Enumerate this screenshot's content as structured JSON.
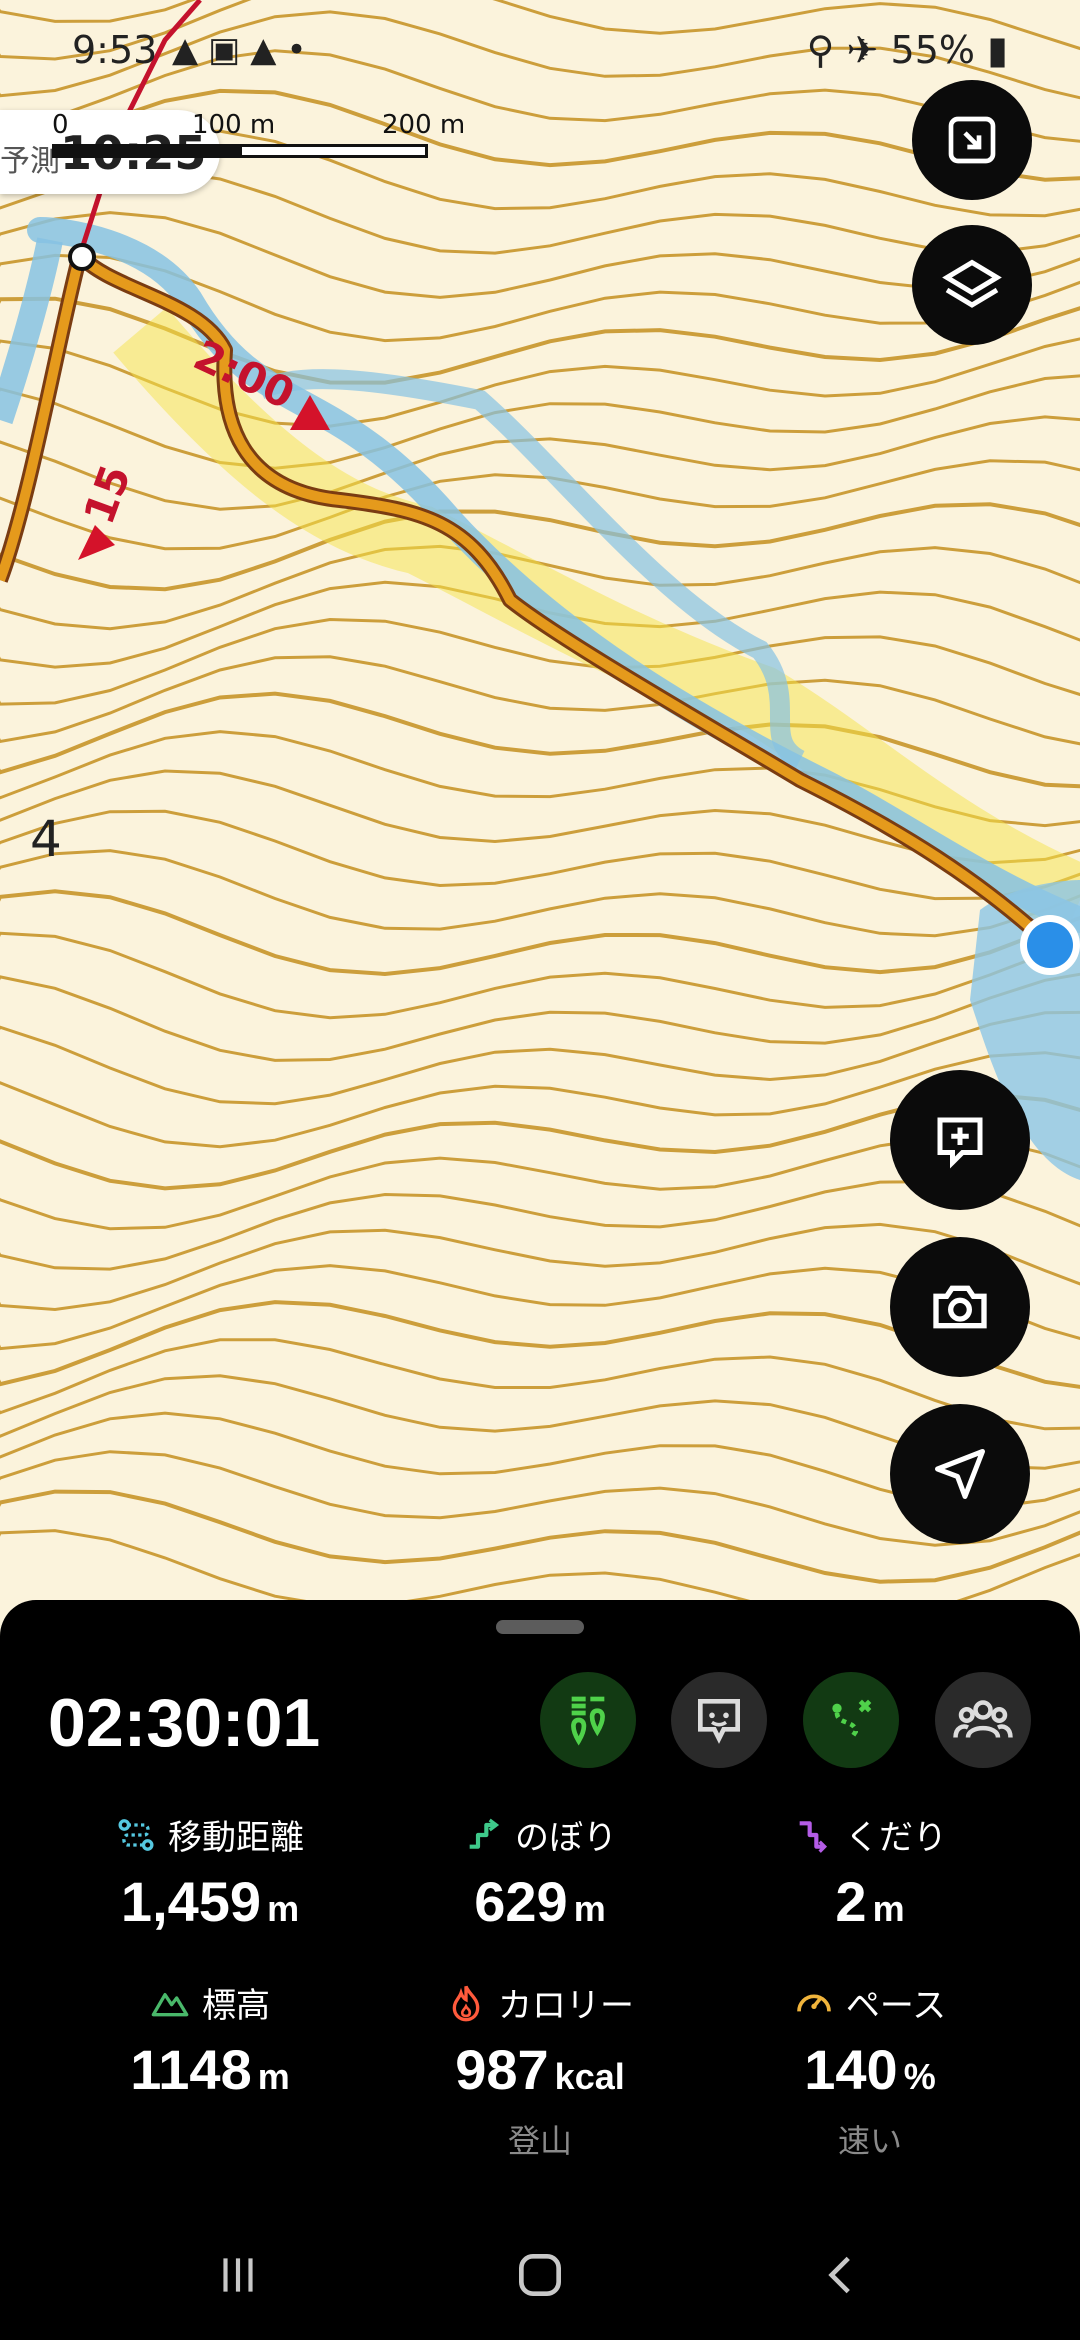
{
  "status_bar": {
    "time": "9:53",
    "left_icons": [
      "navigation-arrow-icon",
      "image-icon",
      "navigation-arrow-icon",
      "dot-icon"
    ],
    "right_icons": [
      "location-icon",
      "airplane-icon",
      "battery-icon"
    ],
    "battery": "55%"
  },
  "map": {
    "eta_label": "予測",
    "eta_value": "10:25",
    "scale_labels": [
      "0",
      "100 m",
      "200 m"
    ],
    "route_labels": [
      "2:00",
      "15"
    ],
    "contour_label": "4",
    "colors": {
      "contour": "#c8952a",
      "track": "#86c2e3",
      "route": "#e59a1c",
      "route_outline": "#7a3c12",
      "location": "#2a8fe8"
    }
  },
  "map_buttons": [
    {
      "name": "fullscreen-button",
      "icon": "expand-icon"
    },
    {
      "name": "layers-button",
      "icon": "layers-icon"
    },
    {
      "name": "add-memo-button",
      "icon": "add-comment-icon"
    },
    {
      "name": "camera-button",
      "icon": "camera-icon"
    },
    {
      "name": "navigate-button",
      "icon": "navigation-icon"
    }
  ],
  "panel": {
    "elapsed_time": "02:30:01",
    "toolbar": [
      {
        "name": "checkpoint-button",
        "icon": "pins-icon",
        "color": "#4fd14a"
      },
      {
        "name": "message-button",
        "icon": "chat-icon",
        "color": "#dcdcdc"
      },
      {
        "name": "route-button",
        "icon": "route-icon",
        "color": "#4fd14a"
      },
      {
        "name": "group-button",
        "icon": "group-icon",
        "color": "#dcdcdc"
      }
    ],
    "stats": [
      {
        "label": "移動距離",
        "value": "1,459",
        "unit": "m",
        "sub": "",
        "icon": "distance-icon",
        "color": "#55c8e0"
      },
      {
        "label": "のぼり",
        "value": "629",
        "unit": "m",
        "sub": "",
        "icon": "ascent-icon",
        "color": "#3ec98a"
      },
      {
        "label": "くだり",
        "value": "2",
        "unit": "m",
        "sub": "",
        "icon": "descent-icon",
        "color": "#b45ce6"
      },
      {
        "label": "標高",
        "value": "1148",
        "unit": "m",
        "sub": "",
        "icon": "mountain-icon",
        "color": "#49b86a"
      },
      {
        "label": "カロリー",
        "value": "987",
        "unit": "kcal",
        "sub": "登山",
        "icon": "flame-icon",
        "color": "#ff5a3c"
      },
      {
        "label": "ペース",
        "value": "140",
        "unit": "%",
        "sub": "速い",
        "icon": "speedometer-icon",
        "color": "#f0b43c"
      }
    ]
  },
  "nav_bar": {
    "buttons": [
      {
        "name": "recent-apps-button",
        "icon": "recents-icon"
      },
      {
        "name": "home-button",
        "icon": "home-icon"
      },
      {
        "name": "back-button",
        "icon": "back-icon"
      }
    ]
  }
}
